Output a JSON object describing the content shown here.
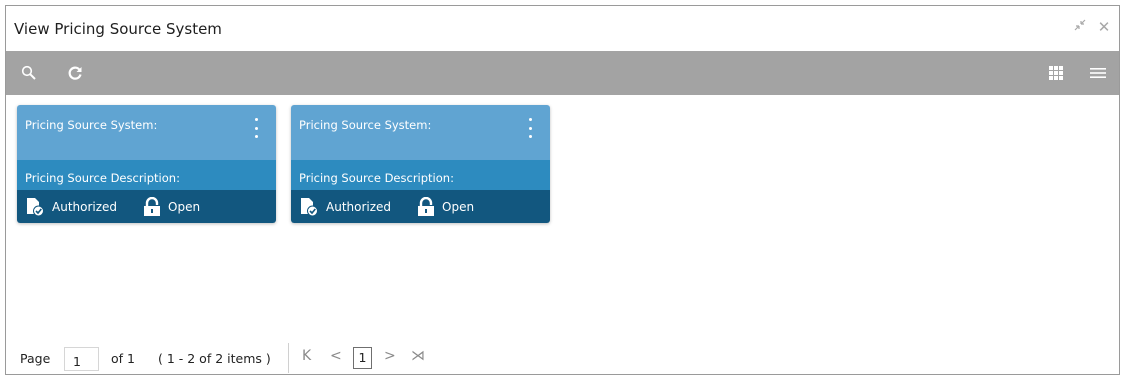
{
  "window": {
    "title": "View Pricing Source System",
    "minimize_glyph": "⤡",
    "close_glyph": "✕"
  },
  "toolbar": {
    "icons": [
      "search-icon",
      "refresh-icon",
      "grid-view-icon",
      "list-view-icon"
    ]
  },
  "cards": [
    {
      "system_label": "Pricing Source System:",
      "description_label": "Pricing Source Description:",
      "auth_status": "Authorized",
      "record_status": "Open"
    },
    {
      "system_label": "Pricing Source System:",
      "description_label": "Pricing Source Description:",
      "auth_status": "Authorized",
      "record_status": "Open"
    }
  ],
  "pager": {
    "page_label": "Page",
    "page_value": "1",
    "of_label": "of 1",
    "items_label": "( 1 - 2 of 2 items )",
    "first_glyph": "K",
    "prev_glyph": "<",
    "current_page": "1",
    "next_glyph": ">",
    "last_glyph": "⋊"
  },
  "colors": {
    "toolbar": "#a3a3a3",
    "card_top": "#60a4d2",
    "card_mid": "#2d8bbf",
    "card_bottom": "#12577f"
  }
}
